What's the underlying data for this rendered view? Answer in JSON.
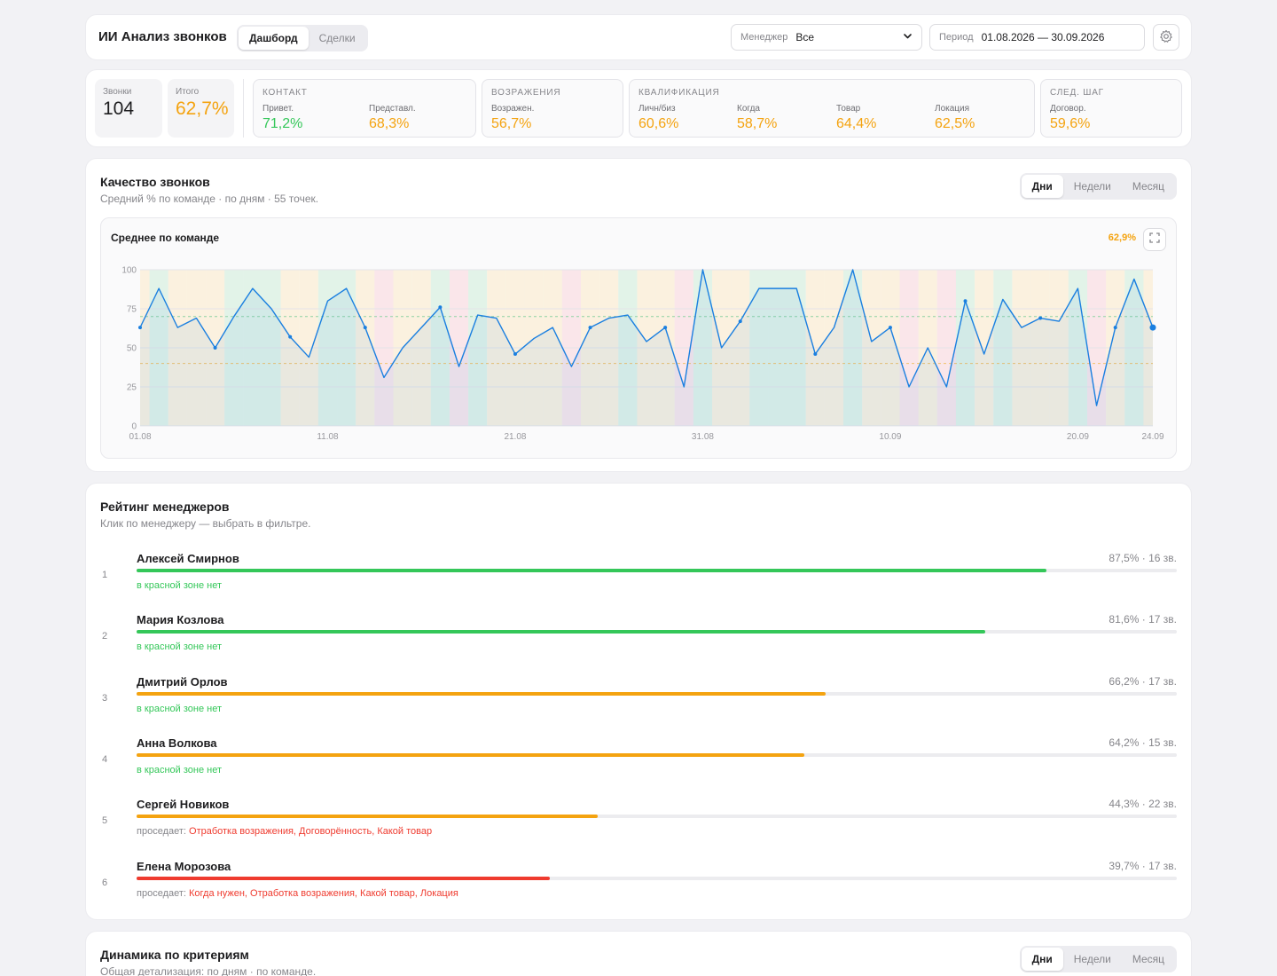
{
  "header": {
    "title": "ИИ Анализ звонков",
    "tabs": [
      "Дашборд",
      "Сделки"
    ],
    "manager_label": "Менеджер",
    "manager_value": "Все",
    "period_label": "Период",
    "period_value": "01.08.2026 — 30.09.2026"
  },
  "kpi": {
    "calls_label": "Звонки",
    "calls_value": "104",
    "total_label": "Итого",
    "total_value": "62,7%",
    "contact": {
      "title": "КОНТАКТ",
      "items": [
        {
          "label": "Привет.",
          "value": "71,2%"
        },
        {
          "label": "Представл.",
          "value": "68,3%"
        }
      ]
    },
    "objections": {
      "title": "ВОЗРАЖЕНИЯ",
      "items": [
        {
          "label": "Возражен.",
          "value": "56,7%"
        }
      ]
    },
    "qualification": {
      "title": "КВАЛИФИКАЦИЯ",
      "items": [
        {
          "label": "Личн/биз",
          "value": "60,6%"
        },
        {
          "label": "Когда",
          "value": "58,7%"
        },
        {
          "label": "Товар",
          "value": "64,4%"
        },
        {
          "label": "Локация",
          "value": "62,5%"
        }
      ]
    },
    "next_step": {
      "title": "СЛЕД. ШАГ",
      "items": [
        {
          "label": "Договор.",
          "value": "59,6%"
        }
      ]
    }
  },
  "quality": {
    "title": "Качество звонков",
    "subtitle": "Средний % по команде · по дням · 55 точек.",
    "periods": [
      "Дни",
      "Недели",
      "Месяц"
    ],
    "chart_title": "Среднее по команде",
    "avg_value": "62,9%"
  },
  "chart_data": {
    "type": "line",
    "title": "Среднее по команде",
    "x_ticks": [
      "01.08",
      "11.08",
      "21.08",
      "31.08",
      "10.09",
      "20.09",
      "24.09"
    ],
    "y_ticks": [
      0,
      25,
      50,
      75,
      100
    ],
    "ylim": [
      0,
      100
    ],
    "reference_lines": [
      70,
      40
    ],
    "series": [
      {
        "values": [
          63,
          88,
          63,
          69,
          50,
          70,
          88,
          75,
          57,
          44,
          80,
          88,
          63,
          31,
          50,
          63,
          76,
          38,
          71,
          69,
          46,
          56,
          63,
          38,
          63,
          69,
          71,
          54,
          63,
          25,
          100,
          50,
          67,
          88,
          88,
          88,
          46,
          63,
          100,
          54,
          63,
          25,
          50,
          25,
          80,
          46,
          81,
          63,
          69,
          67,
          88,
          13,
          63,
          94,
          63
        ],
        "color": "#1a7fe0"
      }
    ],
    "band_colors": {
      "green": "#d7f0df",
      "orange": "#fbecd3",
      "red": "#f9dde3"
    }
  },
  "ranking": {
    "title": "Рейтинг менеджеров",
    "subtitle": "Клик по менеджеру — выбрать в фильтре.",
    "ok_text": "в красной зоне нет",
    "sag_prefix": "проседает:",
    "managers": [
      {
        "rank": "1",
        "name": "Алексей Смирнов",
        "summary": "87,5% · 16 зв.",
        "percent": 87.5,
        "color": "#34c759",
        "note": "",
        "weak": ""
      },
      {
        "rank": "2",
        "name": "Мария Козлова",
        "summary": "81,6% · 17 зв.",
        "percent": 81.6,
        "color": "#34c759",
        "note": "",
        "weak": ""
      },
      {
        "rank": "3",
        "name": "Дмитрий Орлов",
        "summary": "66,2% · 17 зв.",
        "percent": 66.2,
        "color": "#f4a310",
        "note": "",
        "weak": ""
      },
      {
        "rank": "4",
        "name": "Анна Волкова",
        "summary": "64,2% · 15 зв.",
        "percent": 64.2,
        "color": "#f4a310",
        "note": "",
        "weak": ""
      },
      {
        "rank": "5",
        "name": "Сергей Новиков",
        "summary": "44,3% · 22 зв.",
        "percent": 44.3,
        "color": "#f4a310",
        "note": "sag",
        "weak": "Отработка возражения, Договорённость, Какой товар"
      },
      {
        "rank": "6",
        "name": "Елена Морозова",
        "summary": "39,7% · 17 зв.",
        "percent": 39.7,
        "color": "#ef3b2f",
        "note": "sag",
        "weak": "Когда нужен, Отработка возражения, Какой товар, Локация"
      }
    ]
  },
  "dynamics": {
    "title": "Динамика по критериям",
    "subtitle": "Общая детализация: по дням · по команде.",
    "periods": [
      "Дни",
      "Недели",
      "Месяц"
    ]
  }
}
